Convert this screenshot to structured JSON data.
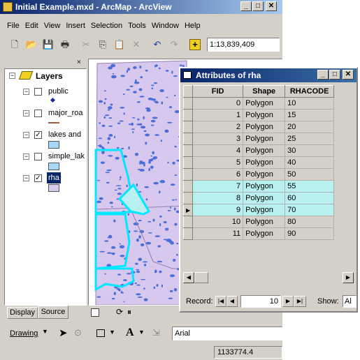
{
  "window": {
    "title": "Initial Example.mxd - ArcMap - ArcView"
  },
  "menu": [
    "File",
    "Edit",
    "View",
    "Insert",
    "Selection",
    "Tools",
    "Window",
    "Help"
  ],
  "toolbar": {
    "scale": "1:13,839,409"
  },
  "toc": {
    "root": "Layers",
    "layers": [
      {
        "name": "public",
        "checked": false,
        "symbol": "point"
      },
      {
        "name": "major_roa",
        "checked": false,
        "symbol": "line"
      },
      {
        "name": "lakes and",
        "checked": true,
        "symbol": "fill-blue"
      },
      {
        "name": "simple_lak",
        "checked": false,
        "symbol": "fill-blue"
      },
      {
        "name": "rha",
        "checked": true,
        "symbol": "fill-lavender",
        "selected": true
      }
    ],
    "tabs": [
      "Display",
      "Source"
    ]
  },
  "attributes": {
    "title": "Attributes of rha",
    "columns": [
      "FID",
      "Shape",
      "RHACODE"
    ],
    "rows": [
      [
        "0",
        "Polygon",
        "10"
      ],
      [
        "1",
        "Polygon",
        "15"
      ],
      [
        "2",
        "Polygon",
        "20"
      ],
      [
        "3",
        "Polygon",
        "25"
      ],
      [
        "4",
        "Polygon",
        "30"
      ],
      [
        "5",
        "Polygon",
        "40"
      ],
      [
        "6",
        "Polygon",
        "50"
      ],
      [
        "7",
        "Polygon",
        "55"
      ],
      [
        "8",
        "Polygon",
        "60"
      ],
      [
        "9",
        "Polygon",
        "70"
      ],
      [
        "10",
        "Polygon",
        "80"
      ],
      [
        "11",
        "Polygon",
        "90"
      ]
    ],
    "highlighted_rows": [
      7,
      8,
      9
    ],
    "current_row": 9,
    "record_label": "Record:",
    "record_value": "10",
    "show_label": "Show:",
    "show_value": "Al"
  },
  "drawing": {
    "label": "Drawing",
    "font": "Arial"
  },
  "status": {
    "coords": "1133774.4"
  },
  "colors": {
    "titlebar": "#0a246a",
    "selection": "#00e8ff",
    "lakes": "#4a6fd8",
    "rha_fill": "#d9c8ee",
    "highlight": "#b8f0f0"
  }
}
